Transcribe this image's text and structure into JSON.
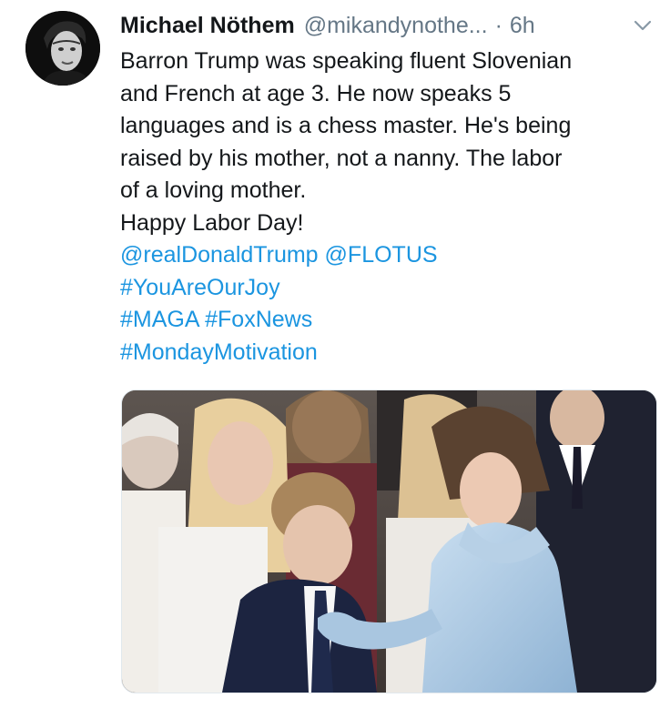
{
  "tweet": {
    "author": {
      "display_name": "Michael Nöthem",
      "handle": "@mikandynothe...",
      "avatar_icon": "avatar-photo"
    },
    "separator": "·",
    "timestamp": "6h",
    "menu_icon": "chevron-down-icon",
    "text_lines": [
      "Barron Trump was speaking fluent Slovenian",
      "and French at age 3. He now speaks 5",
      "languages and is a chess master. He's being",
      "raised by his mother, not a nanny. The labor",
      "of a loving mother.",
      "Happy Labor Day!"
    ],
    "mentions": [
      "@realDonaldTrump",
      "@FLOTUS"
    ],
    "hashtags": [
      "#YouAreOurJoy",
      "#MAGA",
      "#FoxNews",
      "#MondayMotivation"
    ],
    "colors": {
      "text": "#14171a",
      "secondary": "#657786",
      "link": "#1b95e0"
    }
  }
}
